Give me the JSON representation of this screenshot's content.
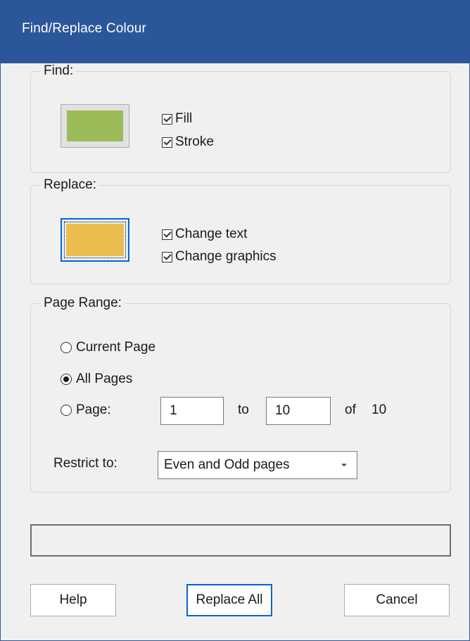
{
  "window": {
    "title": "Find/Replace Colour"
  },
  "find": {
    "legend": "Find:",
    "swatch_color": "#9bbb59",
    "options": [
      {
        "label": "Fill",
        "checked": true
      },
      {
        "label": "Stroke",
        "checked": true
      }
    ]
  },
  "replace": {
    "legend": "Replace:",
    "swatch_color": "#ebbd4e",
    "options": [
      {
        "label": "Change text",
        "checked": true
      },
      {
        "label": "Change graphics",
        "checked": true
      }
    ]
  },
  "page_range": {
    "legend": "Page Range:",
    "options": [
      {
        "label": "Current Page",
        "selected": false
      },
      {
        "label": "All Pages",
        "selected": true
      },
      {
        "label": "Page:",
        "selected": false
      }
    ],
    "from_value": "1",
    "to_label": "to",
    "to_value": "10",
    "of_label": "of",
    "total_pages": "10",
    "restrict_label": "Restrict to:",
    "restrict_value": "Even and Odd pages"
  },
  "progress": {
    "fraction": 0
  },
  "buttons": {
    "help": "Help",
    "replace_all": "Replace All",
    "cancel": "Cancel"
  },
  "colors": {
    "titlebar": "#2b579a",
    "focus": "#0a64d0"
  }
}
